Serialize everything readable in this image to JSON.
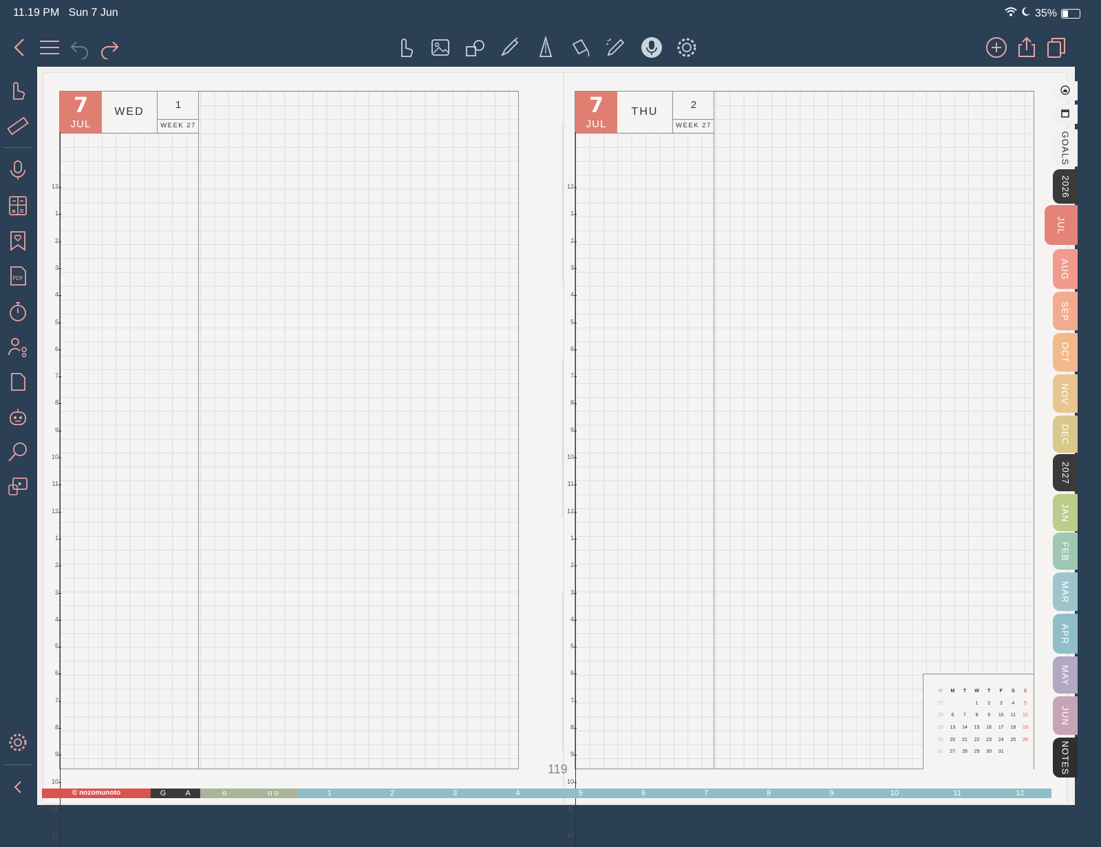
{
  "status": {
    "time": "11.19 PM",
    "date": "Sun 7 Jun",
    "battery": "35%",
    "battery_level": 0.35
  },
  "toolbar": {
    "left": [
      {
        "name": "back-icon"
      },
      {
        "name": "menu-icon"
      },
      {
        "name": "undo-icon"
      },
      {
        "name": "redo-icon"
      }
    ],
    "center": [
      {
        "name": "hand-pointer-icon"
      },
      {
        "name": "image-gallery-icon"
      },
      {
        "name": "shapes-icon"
      },
      {
        "name": "pen-nib-icon"
      },
      {
        "name": "highlighter-icon"
      },
      {
        "name": "magic-bucket-icon"
      },
      {
        "name": "magic-pencil-icon"
      },
      {
        "name": "microphone-icon"
      },
      {
        "name": "gear-icon"
      }
    ],
    "right": [
      {
        "name": "add-icon"
      },
      {
        "name": "share-icon"
      },
      {
        "name": "pages-icon"
      }
    ]
  },
  "sidebar": {
    "items": [
      "hand-icon",
      "ruler-icon",
      "microphone-icon",
      "calculator-icon",
      "bookmark-heart-icon",
      "pdf-icon",
      "timer-icon",
      "share-nodes-icon",
      "document-icon",
      "robot-icon",
      "search-icon",
      "slideshow-icon"
    ],
    "bottom": [
      "settings-icon",
      "collapse-icon"
    ]
  },
  "left_page": {
    "day": "7",
    "month": "JUL",
    "weekday": "WED",
    "day_of_week": "1",
    "week_label": "WEEK 27"
  },
  "right_page": {
    "day": "7",
    "month": "JUL",
    "weekday": "THU",
    "day_of_week": "2",
    "week_label": "WEEK 27"
  },
  "hours": [
    "12",
    "1",
    "2",
    "3",
    "4",
    "5",
    "6",
    "7",
    "8",
    "9",
    "10",
    "11",
    "12",
    "1",
    "2",
    "3",
    "4",
    "5",
    "6",
    "7",
    "8",
    "9",
    "10",
    "11",
    "12"
  ],
  "page_number": "119",
  "mini_calendar": {
    "header": [
      "W",
      "M",
      "T",
      "W",
      "T",
      "F",
      "S",
      "S"
    ],
    "rows": [
      [
        "27",
        "",
        "",
        "1",
        "2",
        "3",
        "4",
        "5"
      ],
      [
        "28",
        "6",
        "7",
        "8",
        "9",
        "10",
        "11",
        "12"
      ],
      [
        "29",
        "13",
        "14",
        "15",
        "16",
        "17",
        "18",
        "19"
      ],
      [
        "30",
        "20",
        "21",
        "22",
        "23",
        "24",
        "25",
        "26"
      ],
      [
        "31",
        "27",
        "28",
        "29",
        "30",
        "31",
        "",
        ""
      ]
    ]
  },
  "tabs": [
    {
      "label": "",
      "icon": "home-icon",
      "color": "#f1f1f1",
      "text": "#333"
    },
    {
      "label": "",
      "icon": "square-icon",
      "color": "#f1f1f1",
      "text": "#333"
    },
    {
      "label": "GOALS",
      "color": "#f1f1f1",
      "text": "#333"
    },
    {
      "label": "2026",
      "color": "#3a3a3a",
      "text": "#fff"
    },
    {
      "label": "JUL",
      "color": "#e48379",
      "text": "#fff"
    },
    {
      "label": "AUG",
      "color": "#f29a8c",
      "text": "#fff"
    },
    {
      "label": "SEP",
      "color": "#f3ab8f",
      "text": "#fff"
    },
    {
      "label": "OCT",
      "color": "#f2b98a",
      "text": "#fff"
    },
    {
      "label": "NOV",
      "color": "#e9c690",
      "text": "#fff"
    },
    {
      "label": "DEC",
      "color": "#d8c98b",
      "text": "#fff"
    },
    {
      "label": "2027",
      "color": "#3a3a3a",
      "text": "#fff"
    },
    {
      "label": "JAN",
      "color": "#bccc8a",
      "text": "#fff"
    },
    {
      "label": "FEB",
      "color": "#9ec8b4",
      "text": "#fff"
    },
    {
      "label": "MAR",
      "color": "#9fc5cc",
      "text": "#fff"
    },
    {
      "label": "APR",
      "color": "#8fbec9",
      "text": "#fff"
    },
    {
      "label": "MAY",
      "color": "#b3a7c4",
      "text": "#fff"
    },
    {
      "label": "JUN",
      "color": "#c7a3b8",
      "text": "#fff"
    },
    {
      "label": "NOTES",
      "color": "#2f2f2f",
      "text": "#fff"
    }
  ],
  "bottom_bar": {
    "brand": "© nozomunoto",
    "items": [
      "G",
      "A",
      "o",
      "o o",
      "1",
      "2",
      "3",
      "4",
      "5",
      "6",
      "7",
      "8",
      "9",
      "10",
      "11",
      "12"
    ]
  }
}
